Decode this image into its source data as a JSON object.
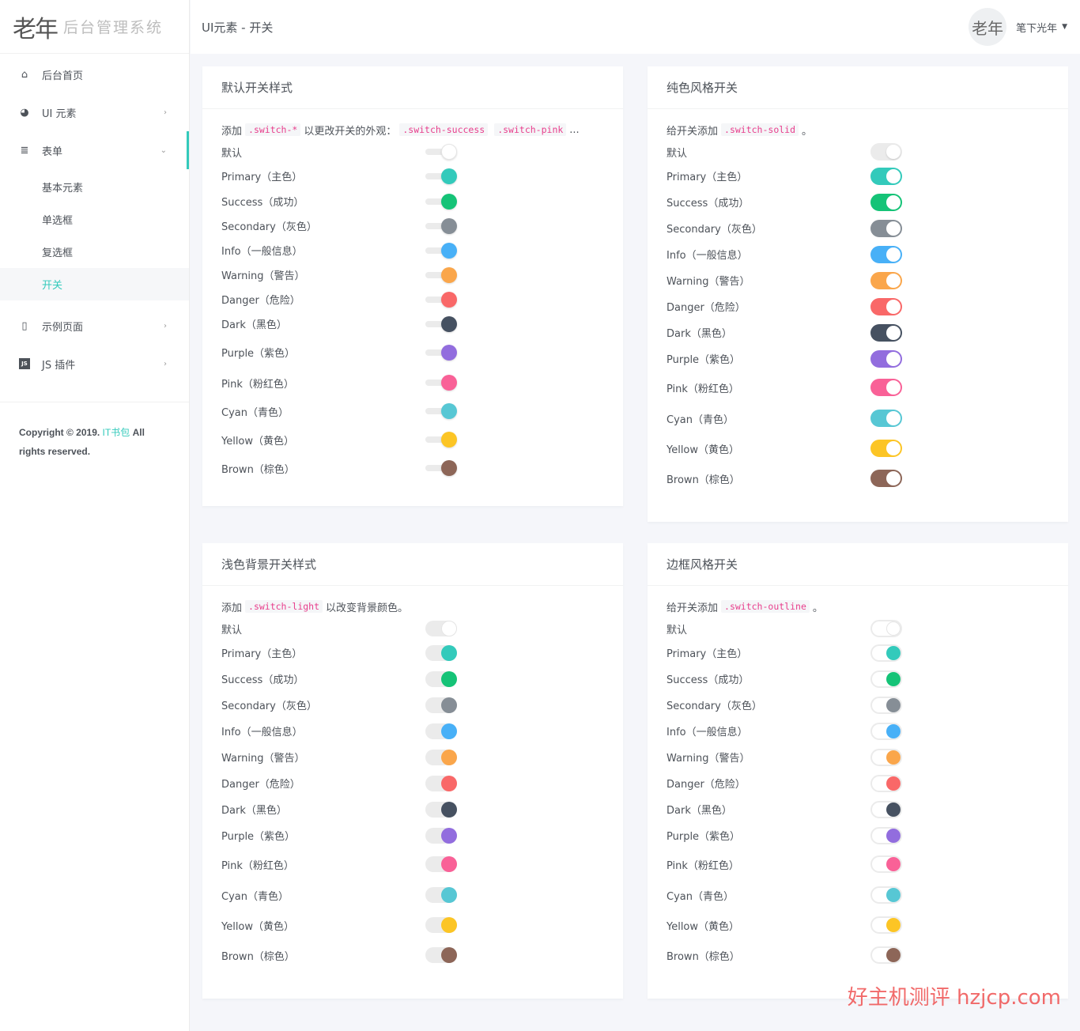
{
  "app": {
    "logo_mark": "老年",
    "logo_text": "后台管理系统"
  },
  "header": {
    "title": "UI元素 - 开关",
    "avatar_text": "老年",
    "user_name": "笔下光年"
  },
  "sidebar": {
    "items": [
      {
        "label": "后台首页",
        "icon": "home-icon",
        "glyph": "⌂"
      },
      {
        "label": "UI 元素",
        "icon": "palette-icon",
        "glyph": "◕",
        "chevron": "›"
      },
      {
        "label": "表单",
        "icon": "list-icon",
        "glyph": "≣",
        "chevron": "⌄"
      }
    ],
    "sub_items": [
      {
        "label": "基本元素"
      },
      {
        "label": "单选框"
      },
      {
        "label": "复选框"
      },
      {
        "label": "开关"
      }
    ],
    "items_after": [
      {
        "label": "示例页面",
        "icon": "file-icon",
        "glyph": "▯",
        "chevron": "›"
      },
      {
        "label": "JS 插件",
        "icon": "js-icon",
        "glyph": "JS",
        "chevron": "›"
      }
    ],
    "copyright_prefix": "Copyright © 2019.",
    "copyright_brand": "IT书包",
    "copyright_suffix": "All rights reserved."
  },
  "colors": {
    "default": "#ffffff",
    "primary": "#33cabb",
    "success": "#15c377",
    "secondary": "#868e96",
    "info": "#48b0f7",
    "warning": "#faa64b",
    "danger": "#f96868",
    "dark": "#465161",
    "purple": "#926dde",
    "pink": "#f96197",
    "cyan": "#57c7d4",
    "yellow": "#fcc525",
    "brown": "#8d6658"
  },
  "switch_labels": [
    {
      "key": "default",
      "label": "默认"
    },
    {
      "key": "primary",
      "label": "Primary（主色）"
    },
    {
      "key": "success",
      "label": "Success（成功）"
    },
    {
      "key": "secondary",
      "label": "Secondary（灰色）"
    },
    {
      "key": "info",
      "label": "Info（一般信息）"
    },
    {
      "key": "warning",
      "label": "Warning（警告）"
    },
    {
      "key": "danger",
      "label": "Danger（危险）"
    },
    {
      "key": "dark",
      "label": "Dark（黑色）"
    },
    {
      "key": "purple",
      "label": "Purple（紫色）"
    },
    {
      "key": "pink",
      "label": "Pink（粉红色）"
    },
    {
      "key": "cyan",
      "label": "Cyan（青色）"
    },
    {
      "key": "yellow",
      "label": "Yellow（黄色）"
    },
    {
      "key": "brown",
      "label": "Brown（棕色）"
    }
  ],
  "cards": {
    "default": {
      "title": "默认开关样式",
      "desc_before": "添加",
      "code1": ".switch-*",
      "desc_middle": "以更改开关的外观：",
      "code2": ".switch-success",
      "code3": ".switch-pink",
      "desc_after": "..."
    },
    "solid": {
      "title": "纯色风格开关",
      "desc_before": "给开关添加",
      "code1": ".switch-solid",
      "desc_after": "。"
    },
    "light": {
      "title": "浅色背景开关样式",
      "desc_before": "添加",
      "code1": ".switch-light",
      "desc_after": "以改变背景颜色。"
    },
    "outline": {
      "title": "边框风格开关",
      "desc_before": "给开关添加",
      "code1": ".switch-outline",
      "desc_after": "。"
    }
  },
  "watermark": "好主机测评 hzjcp.com"
}
